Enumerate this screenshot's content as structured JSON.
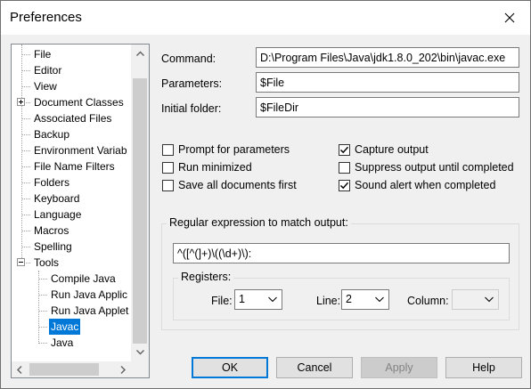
{
  "window": {
    "title": "Preferences"
  },
  "tree": {
    "items": [
      {
        "label": "File"
      },
      {
        "label": "Editor"
      },
      {
        "label": "View"
      },
      {
        "label": "Document Classes",
        "expander": "plus"
      },
      {
        "label": "Associated Files"
      },
      {
        "label": "Backup"
      },
      {
        "label": "Environment Variab"
      },
      {
        "label": "File Name Filters"
      },
      {
        "label": "Folders"
      },
      {
        "label": "Keyboard"
      },
      {
        "label": "Language"
      },
      {
        "label": "Macros"
      },
      {
        "label": "Spelling"
      },
      {
        "label": "Tools",
        "expander": "minus"
      },
      {
        "label": "Compile Java"
      },
      {
        "label": "Run Java Applic"
      },
      {
        "label": "Run Java Applet"
      },
      {
        "label": "Javac",
        "selected": true
      },
      {
        "label": "Java"
      }
    ]
  },
  "form": {
    "command_label": "Command:",
    "command_value": "D:\\Program Files\\Java\\jdk1.8.0_202\\bin\\javac.exe",
    "parameters_label": "Parameters:",
    "parameters_value": "$File",
    "initial_folder_label": "Initial folder:",
    "initial_folder_value": "$FileDir"
  },
  "options": {
    "prompt_for_parameters": {
      "label": "Prompt for parameters",
      "checked": false
    },
    "run_minimized": {
      "label": "Run minimized",
      "checked": false
    },
    "save_all_documents_first": {
      "label": "Save all documents first",
      "checked": false
    },
    "capture_output": {
      "label": "Capture output",
      "checked": true
    },
    "suppress_output": {
      "label": "Suppress output until completed",
      "checked": false
    },
    "sound_alert": {
      "label": "Sound alert when completed",
      "checked": true
    }
  },
  "regex": {
    "group_label": "Regular expression to match output:",
    "value": "^([^(]+)\\((\\d+)\\):",
    "registers_label": "Registers:",
    "file_label": "File:",
    "file_value": "1",
    "line_label": "Line:",
    "line_value": "2",
    "column_label": "Column:",
    "column_value": ""
  },
  "buttons": {
    "ok": "OK",
    "cancel": "Cancel",
    "apply": "Apply",
    "help": "Help"
  },
  "icons": {
    "close": "close-icon",
    "scroll_up": "chevron-up-icon",
    "scroll_down": "chevron-down-icon",
    "scroll_left": "chevron-left-icon",
    "scroll_right": "chevron-right-icon",
    "check": "checkmark-icon",
    "dropdown": "chevron-down-icon"
  },
  "colors": {
    "selection": "#0078d7",
    "background": "#f0f0f0",
    "default_button_border": "#0078d7"
  }
}
